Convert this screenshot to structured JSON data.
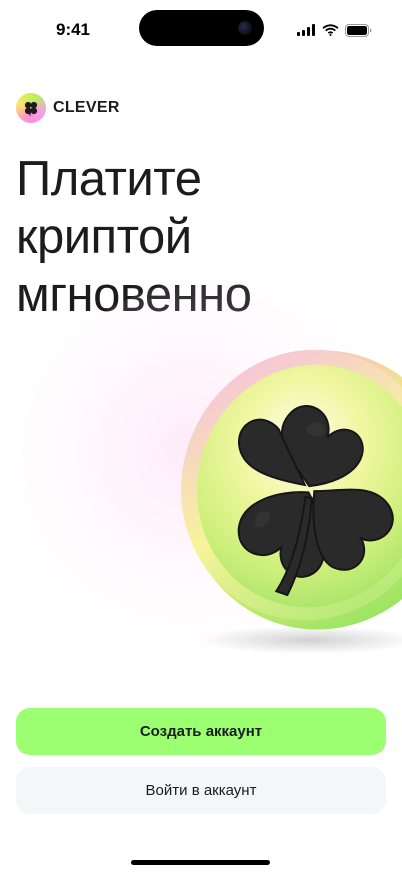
{
  "status_bar": {
    "time": "9:41",
    "icons": [
      "cellular-signal-icon",
      "wifi-icon",
      "battery-icon"
    ]
  },
  "brand": {
    "name": "CLEVER",
    "logo_icon": "clover-icon"
  },
  "headline": {
    "lines": [
      "Платите",
      "криптой",
      "мгновенно"
    ]
  },
  "hero": {
    "icon": "clover-coin-icon"
  },
  "actions": {
    "create_account_label": "Создать аккаунт",
    "login_label": "Войти в аккаунт"
  },
  "colors": {
    "primary_button": "#9cff72",
    "secondary_button": "#f5f6f8",
    "text": "#1c1c1e"
  }
}
